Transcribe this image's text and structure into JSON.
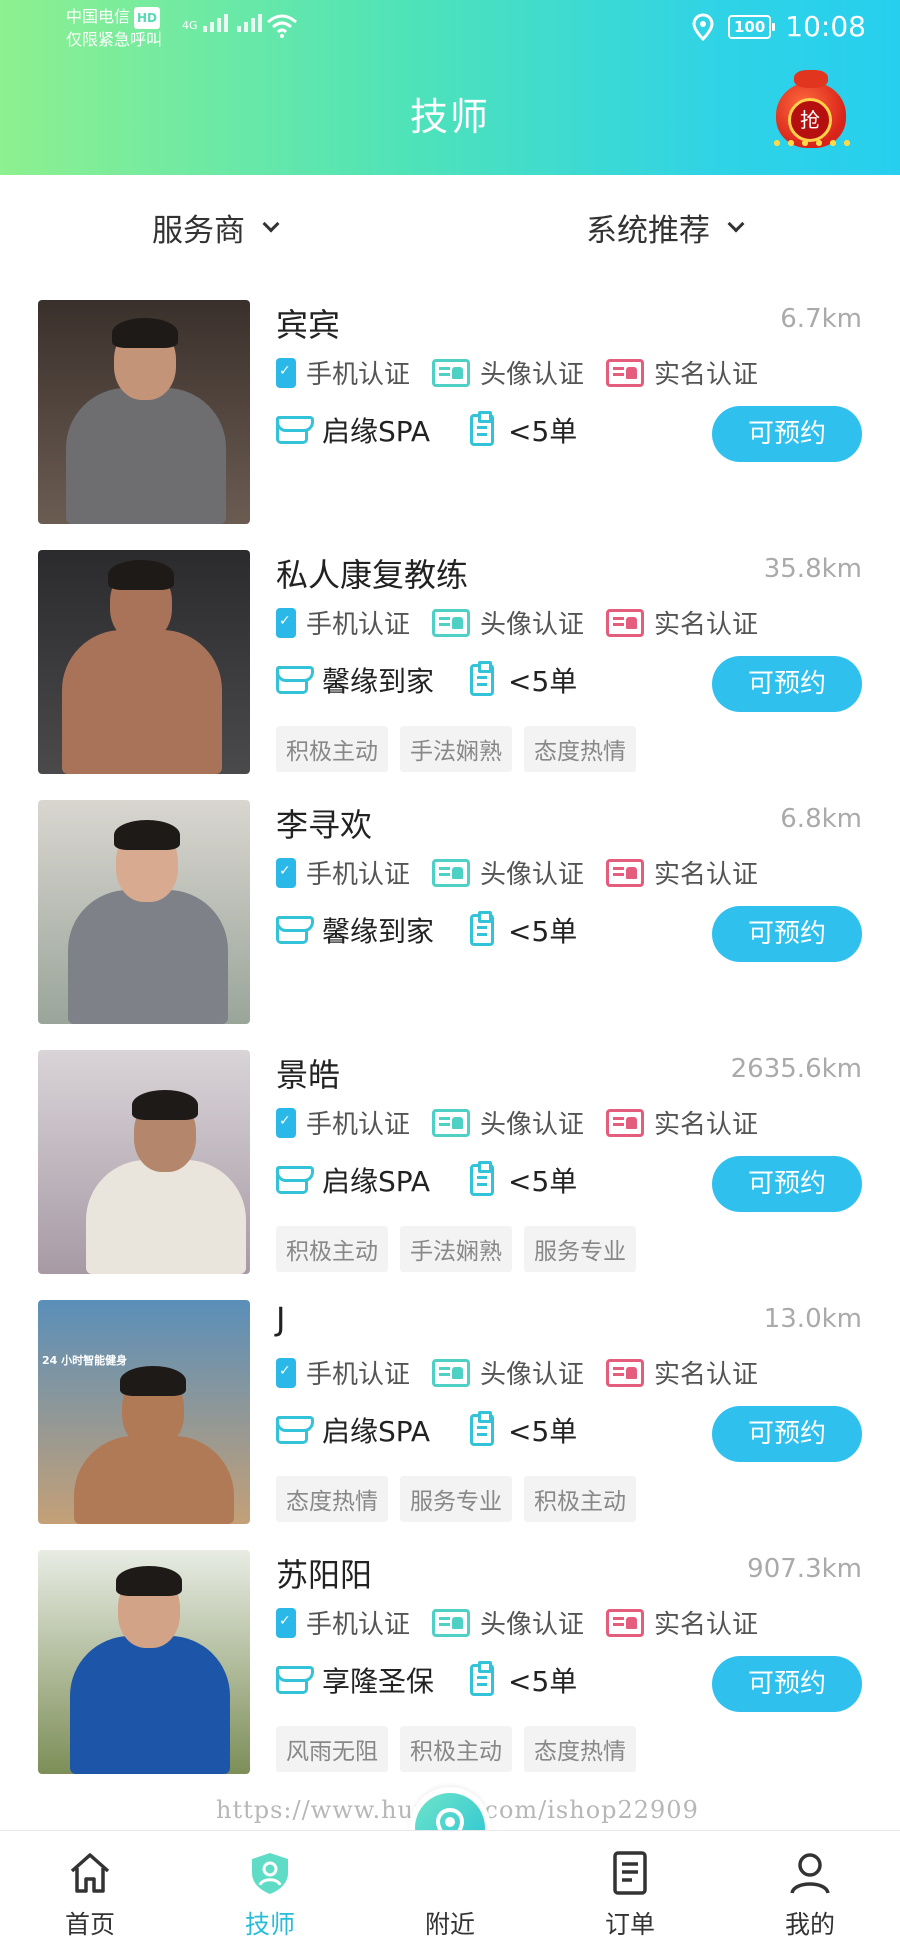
{
  "status_bar": {
    "carrier": "中国电信",
    "hd": "HD",
    "emergency": "仅限紧急呼叫",
    "network": "4G",
    "battery": "100",
    "time": "10:08"
  },
  "header": {
    "title": "技师",
    "grab_label": "抢"
  },
  "filters": {
    "provider": "服务商",
    "sort": "系统推荐"
  },
  "labels": {
    "cert_phone": "手机认证",
    "cert_avatar": "头像认证",
    "cert_realname": "实名认证",
    "book": "可预约"
  },
  "technicians": [
    {
      "name": "宾宾",
      "distance": "6.7km",
      "shop": "启缘SPA",
      "orders": "<5单",
      "tags": []
    },
    {
      "name": "私人康复教练",
      "distance": "35.8km",
      "shop": "馨缘到家",
      "orders": "<5单",
      "tags": [
        "积极主动",
        "手法娴熟",
        "态度热情"
      ]
    },
    {
      "name": "李寻欢",
      "distance": "6.8km",
      "shop": "馨缘到家",
      "orders": "<5单",
      "tags": []
    },
    {
      "name": "景皓",
      "distance": "2635.6km",
      "shop": "启缘SPA",
      "orders": "<5单",
      "tags": [
        "积极主动",
        "手法娴熟",
        "服务专业"
      ]
    },
    {
      "name": "J",
      "distance": "13.0km",
      "shop": "启缘SPA",
      "orders": "<5单",
      "tags": [
        "态度热情",
        "服务专业",
        "积极主动"
      ],
      "photo_sign": "24 小时智能健身"
    },
    {
      "name": "苏阳阳",
      "distance": "907.3km",
      "shop": "享隆圣保",
      "orders": "<5单",
      "tags": [
        "风雨无阻",
        "积极主动",
        "态度热情"
      ]
    }
  ],
  "watermark": "https://www.huzhan.com/ishop22909",
  "tabbar": {
    "home": "首页",
    "technician": "技师",
    "nearby": "附近",
    "orders": "订单",
    "mine": "我的",
    "active": "technician",
    "active_color": "#27bcd8"
  },
  "colors": {
    "header_gradient_start": "#8ef08f",
    "header_gradient_end": "#27cfee",
    "book_button": "#2fc0ee",
    "cert_phone_icon": "#29b8e8",
    "cert_avatar_icon": "#4fd0c4",
    "cert_realname_icon": "#e45d7c"
  }
}
